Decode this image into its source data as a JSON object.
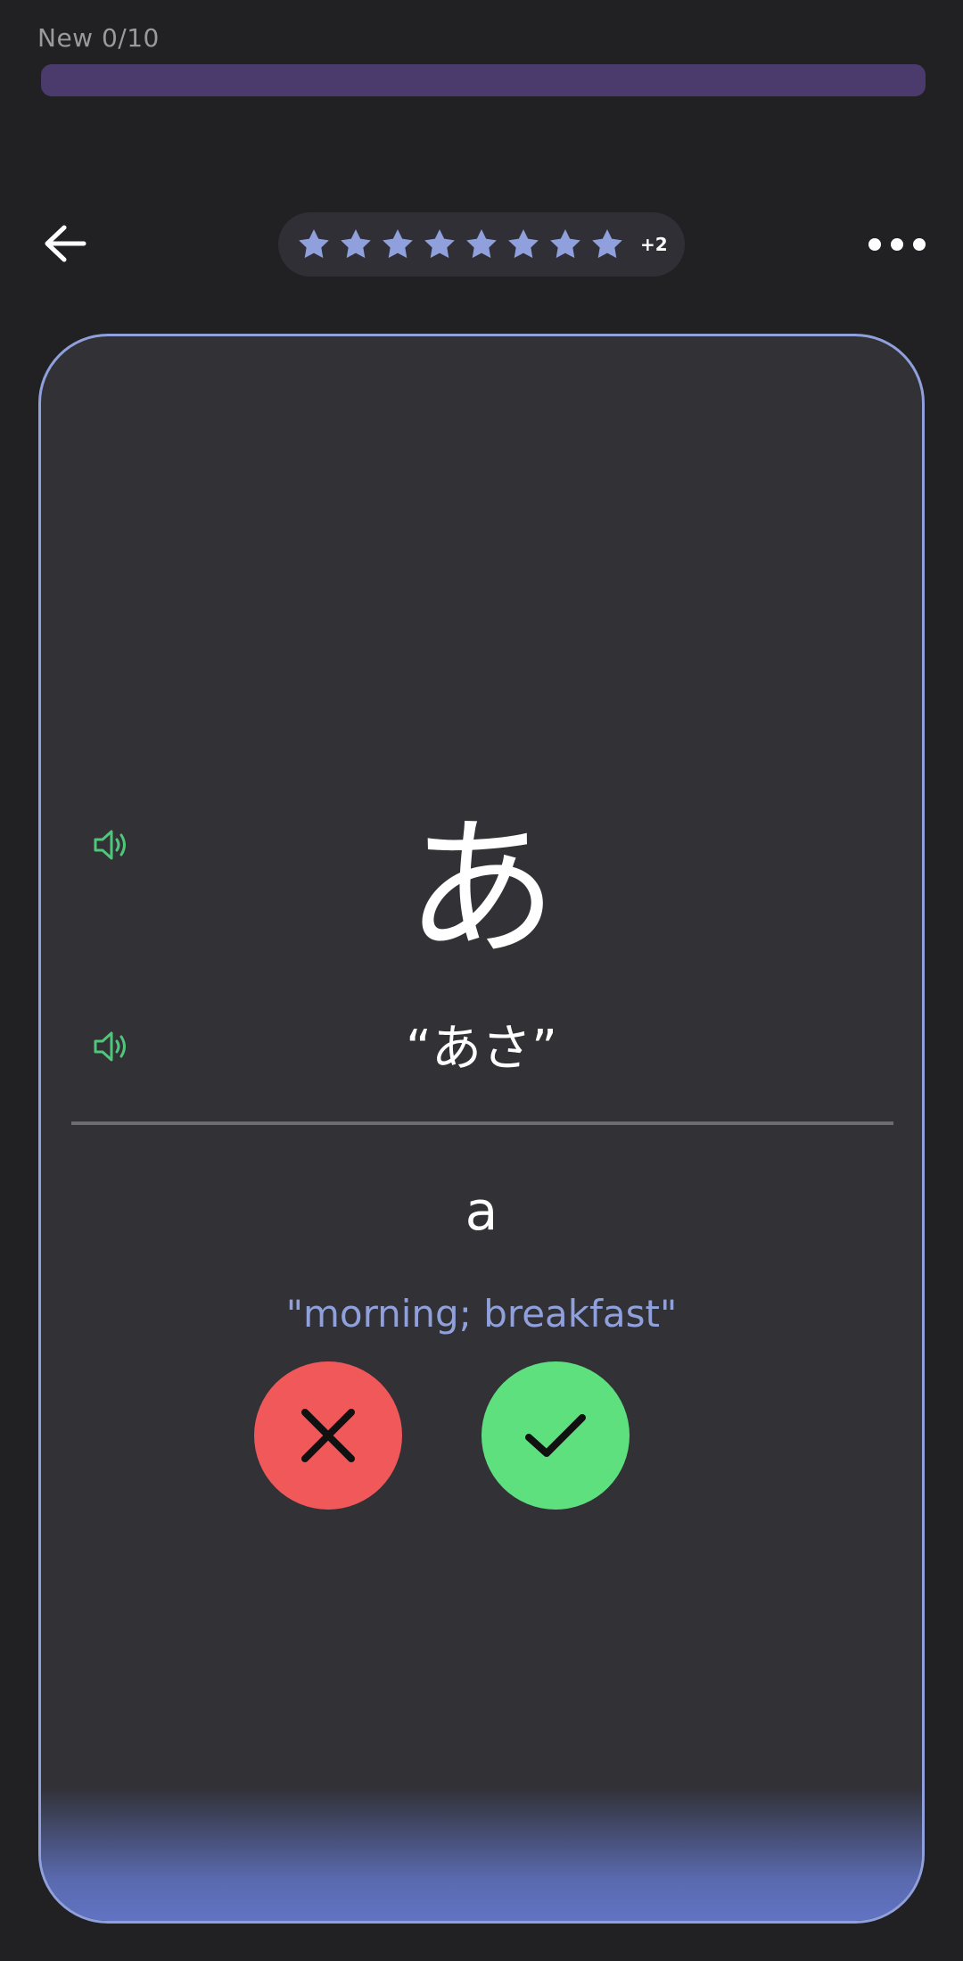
{
  "progress": {
    "label": "New 0/10",
    "value": 0,
    "total": 10,
    "track_color": "#4b3b6c"
  },
  "header": {
    "back_icon": "arrow-left-icon",
    "stars": {
      "count_shown": 8,
      "extra_label": "+2",
      "star_color": "#8fa0dc"
    },
    "more_icon": "more-horizontal-icon"
  },
  "card": {
    "border_color": "#8fa0dc",
    "kana": "あ",
    "word": "“あさ”",
    "romaji": "a",
    "meaning": "\"morning; breakfast\"",
    "speaker_color": "#4fc77a",
    "speaker_icon": "speaker-icon"
  },
  "actions": {
    "wrong_icon": "close-icon",
    "wrong_color": "#f0585a",
    "right_icon": "check-icon",
    "right_color": "#5fe07f"
  }
}
